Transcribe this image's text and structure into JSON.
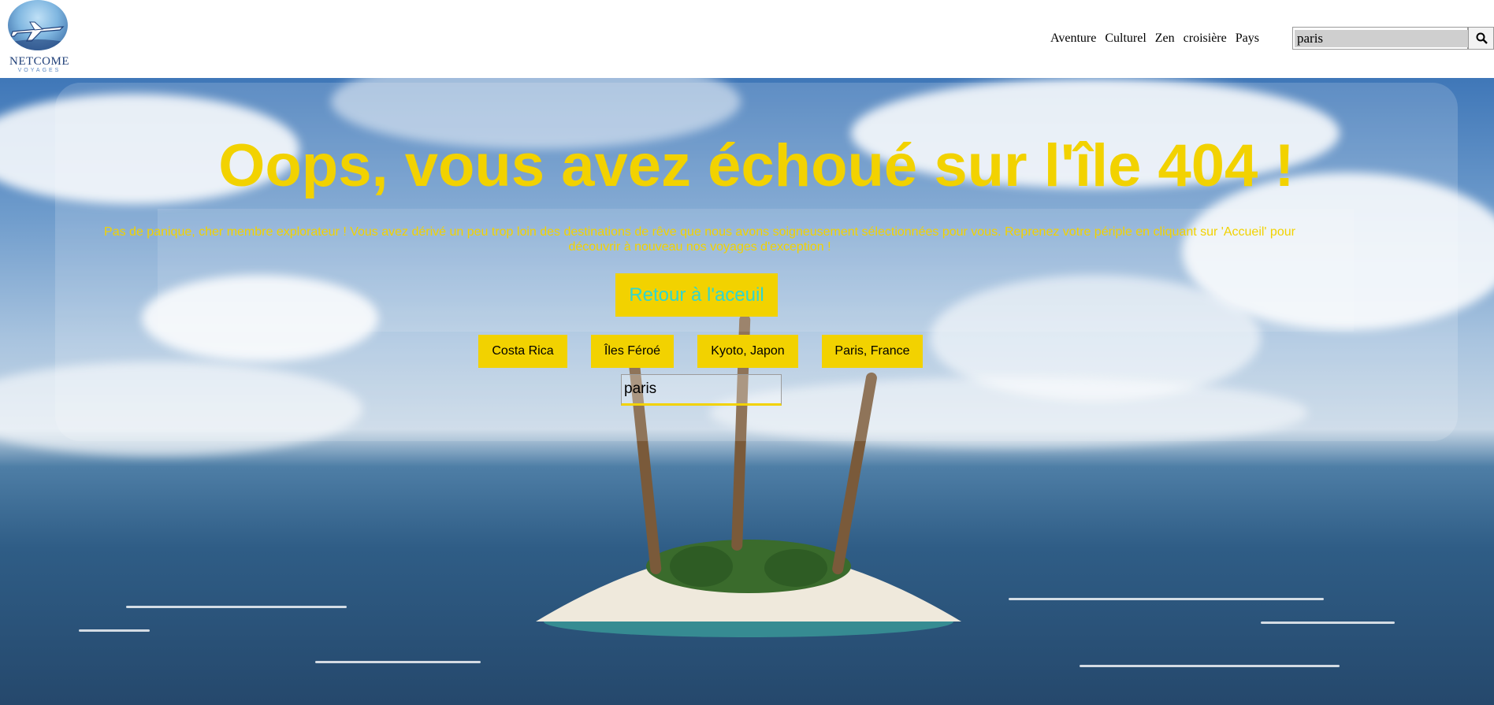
{
  "header": {
    "logo": {
      "word": "NETCOME",
      "sub": "VOYAGES"
    },
    "nav": [
      "Aventure",
      "Culturel",
      "Zen",
      "croisière",
      "Pays"
    ],
    "search": {
      "value": "paris",
      "button_icon": "search-icon"
    }
  },
  "main": {
    "title": "Oops, vous avez échoué sur l'île 404 !",
    "message": "Pas de panique, cher membre explorateur ! Vous avez dérivé un peu trop loin des destinations de rêve que nous avons soigneusement sélectionnées pour vous. Reprenez votre périple en cliquant sur 'Accueil' pour découvrir à nouveau nos voyages d'exception !",
    "home_button": "Retour à l'aceuil",
    "destinations": [
      "Costa Rica",
      "Îles Féroé",
      "Kyoto, Japon",
      "Paris, France"
    ],
    "search_value": "paris"
  },
  "colors": {
    "accent_yellow": "#f2d200",
    "home_button_text": "#2fd6d0",
    "logo_blue": "#1f3f78"
  }
}
